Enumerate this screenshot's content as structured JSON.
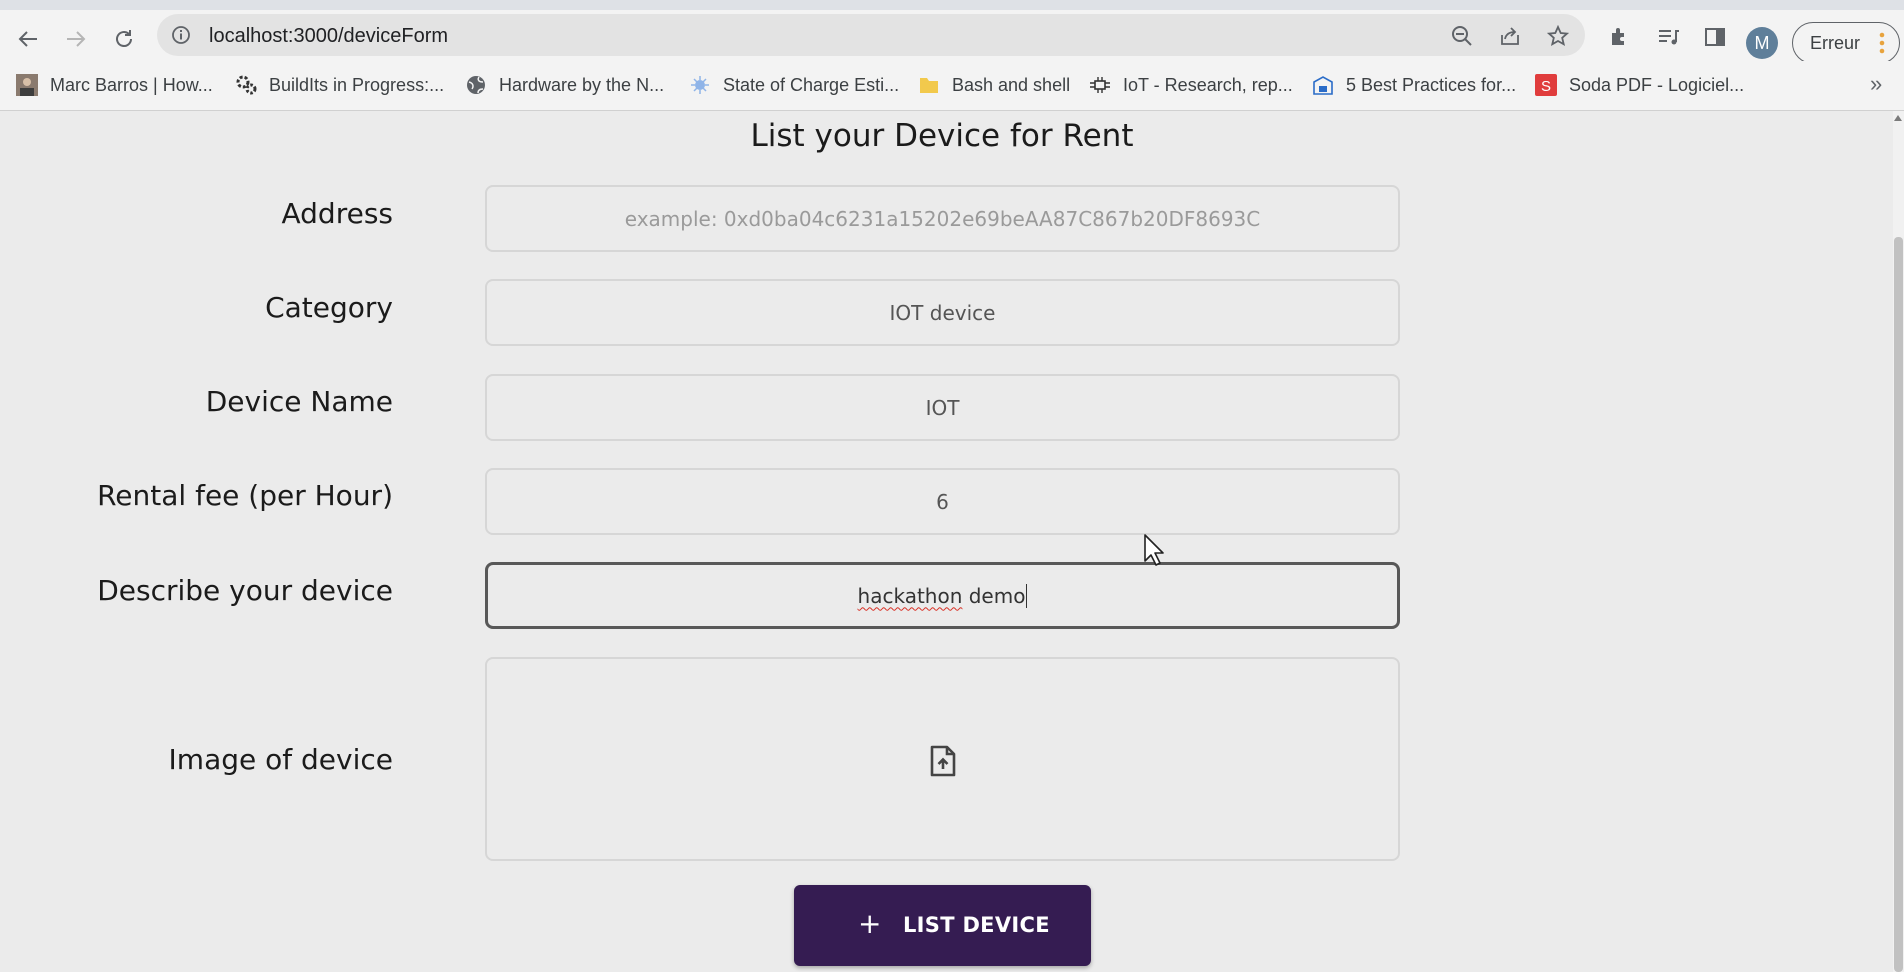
{
  "browser": {
    "url": "localhost:3000/deviceForm",
    "profile_initial": "M",
    "profile_button_label": "Erreur",
    "bookmarks": [
      {
        "label": "Marc Barros | How...",
        "icon": "person-photo-icon"
      },
      {
        "label": "BuildIts in Progress:...",
        "icon": "gears-icon"
      },
      {
        "label": "Hardware by the N...",
        "icon": "globe-icon"
      },
      {
        "label": "State of Charge Esti...",
        "icon": "star-burst-icon"
      },
      {
        "label": "Bash and shell",
        "icon": "folder-icon"
      },
      {
        "label": "IoT - Research, rep...",
        "icon": "circuit-icon"
      },
      {
        "label": "5 Best Practices for...",
        "icon": "document-icon"
      },
      {
        "label": "Soda PDF - Logiciel...",
        "icon": "soda-pdf-icon"
      }
    ],
    "more_bookmarks": "»"
  },
  "form": {
    "title": "List your Device for Rent",
    "address": {
      "label": "Address",
      "placeholder": "example: 0xd0ba04c6231a15202e69beAA87C867b20DF8693C"
    },
    "category": {
      "label": "Category",
      "value": "IOT device"
    },
    "device_name": {
      "label": "Device Name",
      "value": "IOT"
    },
    "rental_fee": {
      "label": "Rental fee (per Hour)",
      "value": "6"
    },
    "description": {
      "label": "Describe your device",
      "value_word1": "hackathon",
      "value_word2": " demo"
    },
    "image": {
      "label": "Image of device",
      "icon": "file-upload-icon"
    },
    "submit": {
      "icon": "+",
      "label": "LIST DEVICE"
    }
  },
  "colors": {
    "page_background": "#ebebeb",
    "button_background": "#351c52",
    "button_text": "#ffffff",
    "field_border": "#d6d6d6",
    "focused_border": "#585858"
  }
}
